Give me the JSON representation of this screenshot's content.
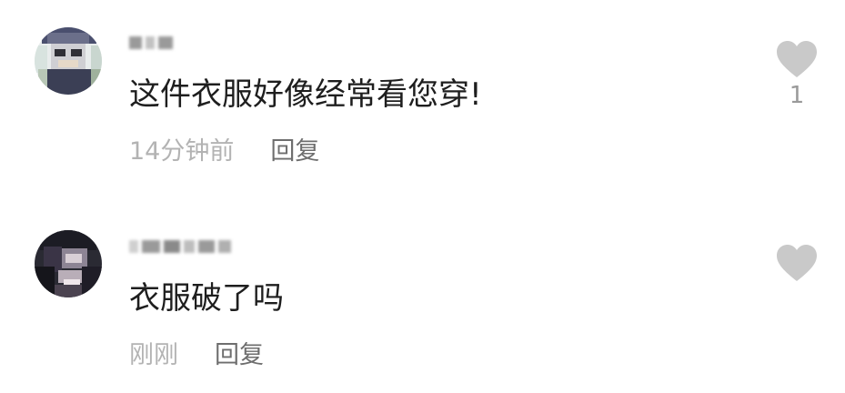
{
  "comments": [
    {
      "text": "这件衣服好像经常看您穿!",
      "time": "14分钟前",
      "reply_label": "回复",
      "like_count": "1",
      "avatar_icon": "user-avatar-pixelated"
    },
    {
      "text": "衣服破了吗",
      "time": "刚刚",
      "reply_label": "回复",
      "like_count": "",
      "avatar_icon": "user-avatar-pixelated"
    }
  ],
  "icons": {
    "like": "heart-icon"
  },
  "colors": {
    "text": "#1e1e1e",
    "meta": "#b3b3b3",
    "reply": "#6e6e6e",
    "heart": "#c9c9c9"
  }
}
